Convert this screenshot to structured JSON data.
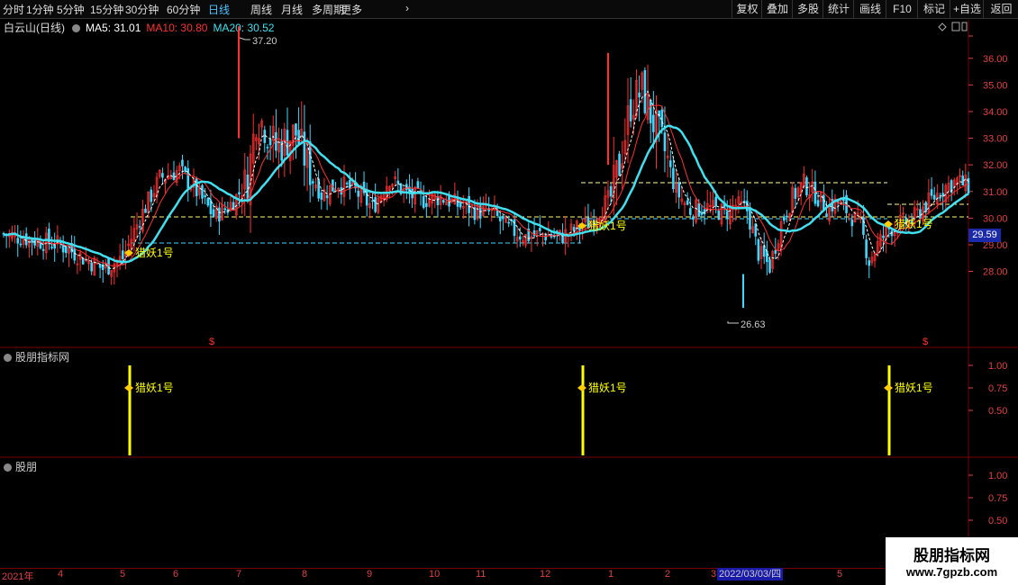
{
  "toolbar": {
    "periods": [
      "分时",
      "1分钟",
      "5分钟",
      "15分钟",
      "30分钟",
      "60分钟",
      "日线",
      "周线",
      "月线",
      "多周期",
      "更多"
    ],
    "active_period": "日线",
    "buttons": [
      "复权",
      "叠加",
      "多股",
      "统计",
      "画线",
      "F10",
      "标记",
      "+自选",
      "返回"
    ]
  },
  "stock": {
    "name": "白云山",
    "period_label": "(日线)",
    "ma5_label": "MA5: 31.01",
    "ma10_label": "MA10: 30.80",
    "ma20_label": "MA20: 30.52",
    "high_label": "37.20",
    "low_label": "26.63",
    "current_price": "29.59"
  },
  "colors": {
    "up": "#ff3030",
    "down": "#40d8ff",
    "ma5": "#ffffff",
    "ma10": "#ff3030",
    "ma20": "#40e0f0",
    "signal": "#ffff00",
    "axis": "#e04040"
  },
  "price_axis": [
    "36.00",
    "35.00",
    "34.00",
    "33.00",
    "32.00",
    "31.00",
    "30.00",
    "29.00",
    "28.00"
  ],
  "signal_label": "猎妖1号",
  "dollar_mark": "$",
  "panel1": {
    "title": "股朋指标网",
    "ticks": [
      "1.00",
      "0.75",
      "0.50"
    ]
  },
  "panel2": {
    "title": "股朋",
    "ticks": [
      "1.00",
      "0.75",
      "0.50"
    ]
  },
  "date_axis": {
    "year_label": "2021年",
    "months": [
      "4",
      "5",
      "6",
      "7",
      "8",
      "9",
      "10",
      "11",
      "12",
      "1",
      "2",
      "3",
      "5"
    ],
    "highlight_date": "2022/03/03/四"
  },
  "watermark": {
    "line1": "股朋指标网",
    "line2": "www.7gpzb.com"
  },
  "chart_data": {
    "type": "candlestick",
    "ylim": [
      26.5,
      37.5
    ],
    "ma_lines": [
      "MA5",
      "MA10",
      "MA20"
    ],
    "high": 37.2,
    "low": 26.63,
    "signal_values": [
      1,
      1,
      1
    ]
  }
}
